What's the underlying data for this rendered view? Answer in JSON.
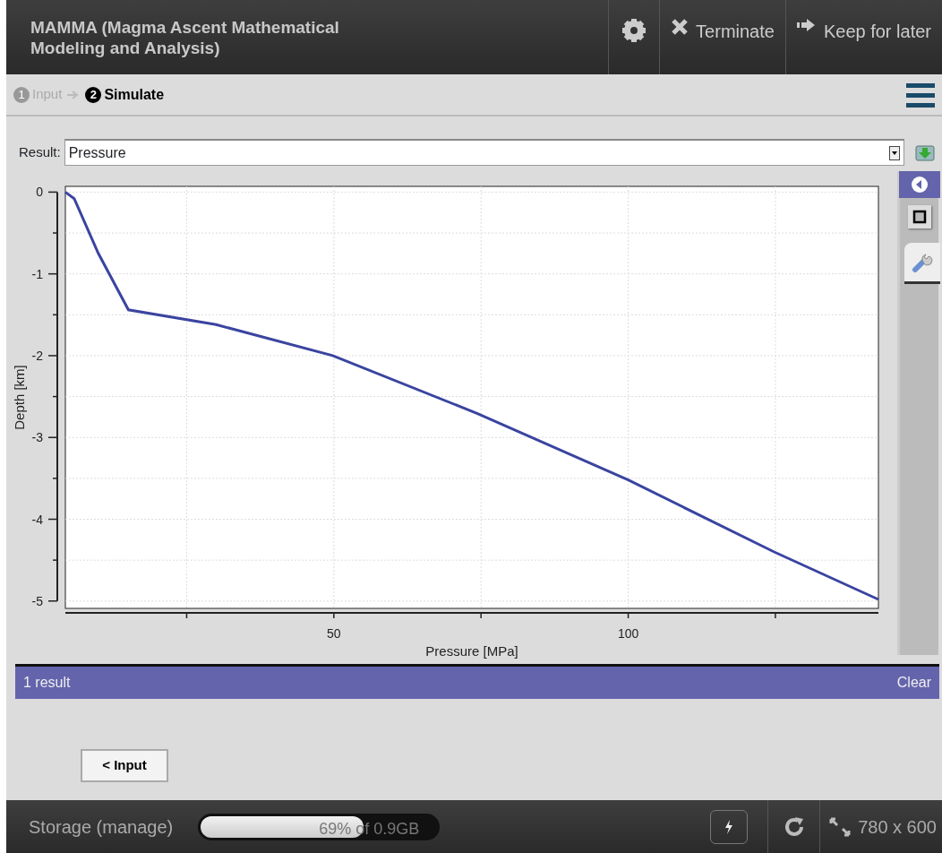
{
  "header": {
    "title": "MAMMA (Magma Ascent Mathematical Modeling and Analysis)",
    "buttons": [
      {
        "kind": "settings"
      },
      {
        "kind": "close",
        "label": "Terminate"
      },
      {
        "kind": "forward",
        "label": "Keep for later"
      }
    ]
  },
  "steps": [
    {
      "number": "1",
      "label": "Input",
      "selected": false
    },
    {
      "number": "2",
      "label": "Simulate",
      "selected": true
    }
  ],
  "result": {
    "label": "Result:",
    "value": "Pressure"
  },
  "chart": {
    "chart_data": {
      "type": "line",
      "xlabel": "Pressure [MPa]",
      "ylabel": "Depth [km]",
      "xlim": [
        4.4,
        142.5
      ],
      "ylim": [
        -5.09,
        0.07
      ],
      "xticks": [
        50,
        100
      ],
      "yticks": [
        0,
        -1,
        -2,
        -3,
        -4,
        -5
      ],
      "grid": true,
      "x": [
        4.4,
        5.9,
        10,
        15.1,
        30,
        49.8,
        74.5,
        100,
        124.8,
        142.5
      ],
      "series": [
        {
          "color": "#3a44a0",
          "values": [
            0,
            -0.08,
            -0.75,
            -1.44,
            -1.62,
            -2.0,
            -2.71,
            -3.52,
            -4.4,
            -4.98
          ]
        }
      ]
    }
  },
  "side_tabs": [
    {
      "kind": "collapse",
      "selected": true
    },
    {
      "kind": "square",
      "selected": false
    },
    {
      "kind": "wrench",
      "selected": false
    }
  ],
  "results_bar": {
    "count": "1 result",
    "clear": "Clear"
  },
  "back_button": "< Input",
  "footer": {
    "storage": "Storage (manage)",
    "usage": {
      "level": 0.69,
      "text": "69% of 0.9GB"
    },
    "size": "780 x 600"
  }
}
